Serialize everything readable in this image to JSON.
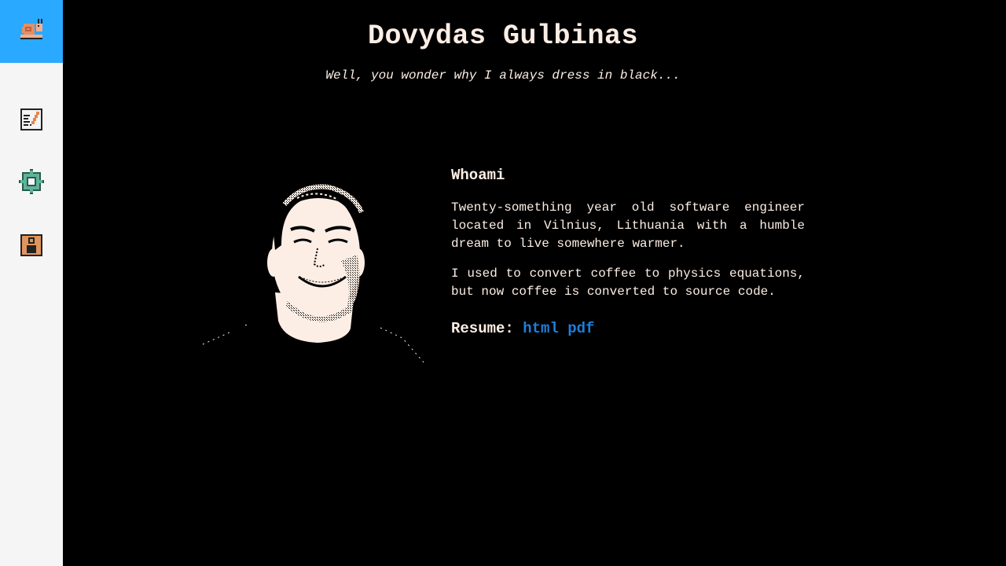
{
  "sidebar": {
    "logo_icon": "snail-icon",
    "accent_color": "#29a9ff",
    "items": [
      {
        "icon": "notepad-icon",
        "label": ""
      },
      {
        "icon": "gear-icon",
        "label": ""
      },
      {
        "icon": "person-icon",
        "label": ""
      }
    ]
  },
  "header": {
    "title": "Dovydas Gulbinas",
    "subtitle": "Well, you wonder why I always dress in black..."
  },
  "about": {
    "heading": "Whoami",
    "paragraph_1": "Twenty-something year old software engineer located in Vilnius, Lithuania with a humble dream to live somewhere warmer.",
    "paragraph_2": "I used to convert coffee to physics equations, but now coffee is converted to source code.",
    "resume_label": "Resume:",
    "resume_links": [
      "html",
      "pdf"
    ],
    "link_color": "#1e7fdc"
  }
}
